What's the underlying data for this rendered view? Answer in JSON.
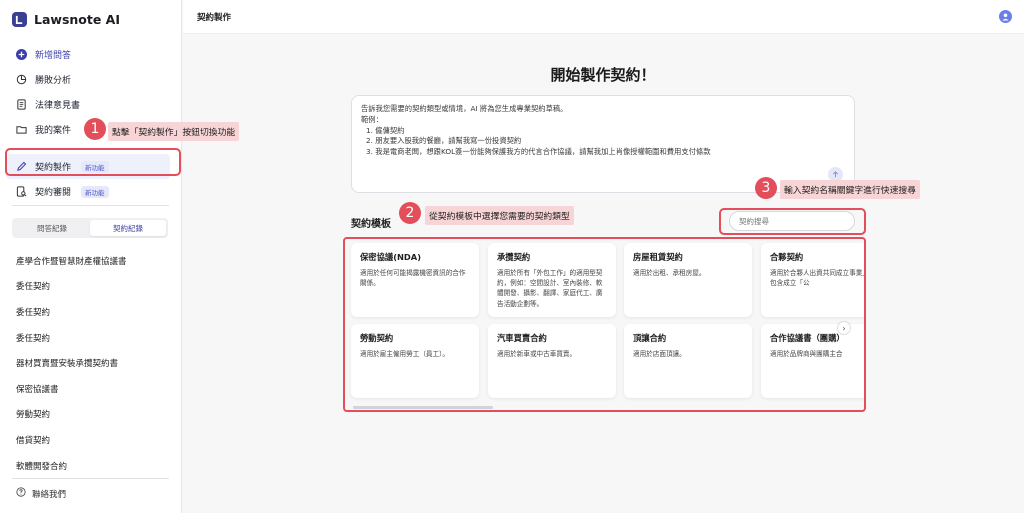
{
  "app": {
    "name": "Lawsnote AI"
  },
  "sidebar": {
    "nav": [
      {
        "label": "新增問答",
        "badge": ""
      },
      {
        "label": "勝敗分析",
        "badge": ""
      },
      {
        "label": "法律意見書",
        "badge": ""
      },
      {
        "label": "我的案件",
        "badge": ""
      },
      {
        "label": "契約製作",
        "badge": "新功能"
      },
      {
        "label": "契約審閱",
        "badge": "新功能"
      }
    ],
    "tabs": [
      "問答紀錄",
      "契約紀錄"
    ],
    "history": [
      "產學合作暨智慧財產權協議書",
      "委任契約",
      "委任契約",
      "委任契約",
      "器材買賣暨安裝承攬契約書",
      "保密協議書",
      "勞動契約",
      "借貸契約",
      "軟體開發合約"
    ],
    "contact": "聯絡我們"
  },
  "topbar": {
    "breadcrumb": "契約製作"
  },
  "main": {
    "heading": "開始製作契約！",
    "prompt_lines": [
      "告訴我您需要的契約類型或情境，AI 將為您生成專業契約草稿。",
      "範例：",
      "1. 僱傭契約",
      "2. 朋友要入股我的餐廳，請幫我寫一份投資契約",
      "3. 我是電商老闆，想跟KOL簽一份能夠保護我方的代言合作協議，請幫我加上肖像授權範圍和費用支付條款"
    ],
    "templates_title": "契約模板",
    "search_placeholder": "契約搜尋",
    "templates": [
      {
        "title": "保密協議(NDA)",
        "desc": "適用於任何可能揭露機密資訊的合作關係。"
      },
      {
        "title": "承攬契約",
        "desc": "適用於所有「外包工作」的適用型契約，例如：空間設計、室內裝修、軟體開發、攝影、翻譯、家庭代工、廣告活動企劃等。"
      },
      {
        "title": "房屋租賃契約",
        "desc": "適用於出租、承租房屋。"
      },
      {
        "title": "合夥契約",
        "desc": "適用於合夥人出資共同成立事業」（不包含成立「公"
      },
      {
        "title": "勞動契約",
        "desc": "適用於雇主僱用勞工（員工）。"
      },
      {
        "title": "汽車買賣合約",
        "desc": "適用於新車或中古車買賣。"
      },
      {
        "title": "頂讓合約",
        "desc": "適用於店面頂讓。"
      },
      {
        "title": "合作協議書（團購）",
        "desc": "適用於品牌商與團購主合"
      }
    ]
  },
  "annotations": [
    {
      "number": "1",
      "text": "點擊「契約製作」按鈕切換功能"
    },
    {
      "number": "2",
      "text": "從契約模板中選擇您需要的契約類型"
    },
    {
      "number": "3",
      "text": "輸入契約名稱關鍵字進行快速搜尋"
    }
  ],
  "colors": {
    "accent": "#3d3fa8",
    "annotation": "#e24e5a",
    "annotation_bg": "#f7d4d6"
  }
}
